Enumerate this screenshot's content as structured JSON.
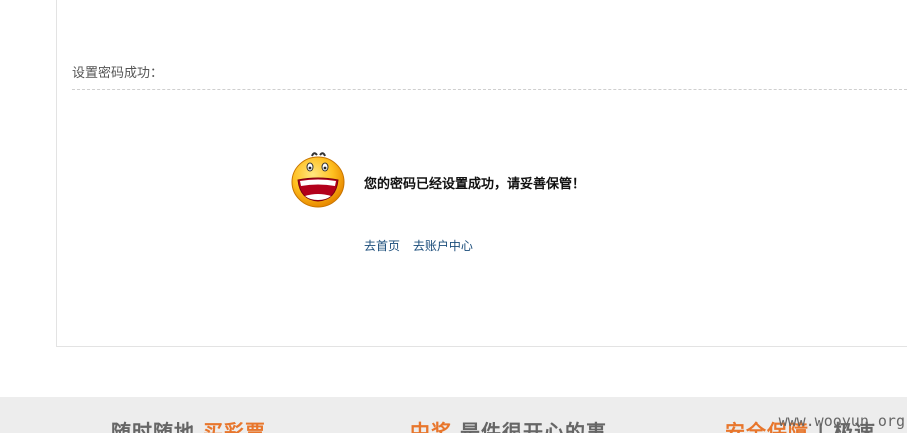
{
  "panel": {
    "title": "设置密码成功："
  },
  "result": {
    "message": "您的密码已经设置成功，请妥善保管！",
    "icon": "smiley-face-icon",
    "links": [
      {
        "label": "去首页"
      },
      {
        "label": "去账户中心"
      }
    ]
  },
  "footer": {
    "slogan1_gray": "随时随地",
    "slogan1_orange": "买彩票",
    "slogan2_orange": "中奖",
    "slogan2_gray": "是件很开心的事",
    "slogan3_orange": "安全保障",
    "slogan3_gray": "| 极速"
  },
  "watermark": "www.wooyun.org",
  "colors": {
    "accent_orange": "#e8762c",
    "link_blue": "#1a4c7a",
    "footer_bg": "#ededed"
  }
}
